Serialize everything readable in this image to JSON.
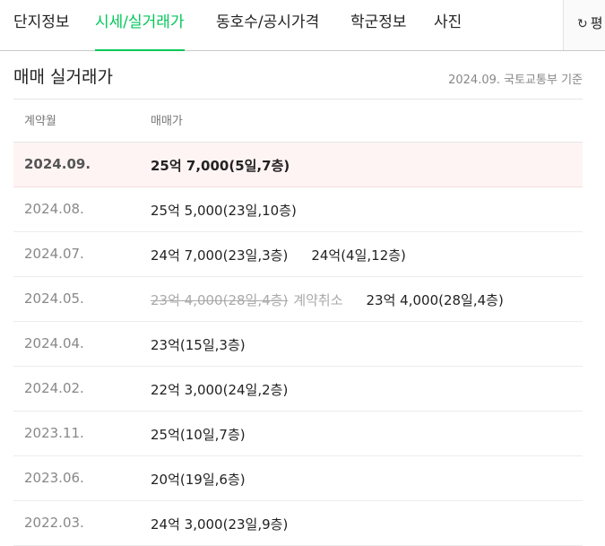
{
  "tabs": [
    {
      "label": "단지정보",
      "active": false
    },
    {
      "label": "시세/실거래가",
      "active": true
    },
    {
      "label": "동호수/공시가격",
      "active": false
    },
    {
      "label": "학군정보",
      "active": false
    },
    {
      "label": "사진",
      "active": false
    }
  ],
  "side_button": {
    "icon": "refresh-icon",
    "label": "평"
  },
  "section": {
    "title": "매매 실거래가",
    "basis": "2024.09. 국토교통부 기준"
  },
  "table": {
    "headers": {
      "month": "계약월",
      "price": "매매가"
    },
    "rows": [
      {
        "month": "2024.09.",
        "highlight": true,
        "trades": [
          {
            "text": "25억 7,000(5일,7층)"
          }
        ]
      },
      {
        "month": "2024.08.",
        "trades": [
          {
            "text": "25억 5,000(23일,10층)"
          }
        ]
      },
      {
        "month": "2024.07.",
        "trades": [
          {
            "text": "24억 7,000(23일,3층)"
          },
          {
            "text": "24억(4일,12층)"
          }
        ]
      },
      {
        "month": "2024.05.",
        "trades": [
          {
            "text": "23억 4,000(28일,4층)",
            "canceled": true,
            "cancel_label": "계약취소"
          },
          {
            "text": "23억 4,000(28일,4층)"
          }
        ]
      },
      {
        "month": "2024.04.",
        "trades": [
          {
            "text": "23억(15일,3층)"
          }
        ]
      },
      {
        "month": "2024.02.",
        "trades": [
          {
            "text": "22억 3,000(24일,2층)"
          }
        ]
      },
      {
        "month": "2023.11.",
        "trades": [
          {
            "text": "25억(10일,7층)"
          }
        ]
      },
      {
        "month": "2023.06.",
        "trades": [
          {
            "text": "20억(19일,6층)"
          }
        ]
      },
      {
        "month": "2022.03.",
        "trades": [
          {
            "text": "24억 3,000(23일,9층)"
          }
        ]
      }
    ]
  },
  "colors": {
    "accent": "#03c75a",
    "highlight_row": "#fff4f4",
    "muted": "#888888"
  }
}
